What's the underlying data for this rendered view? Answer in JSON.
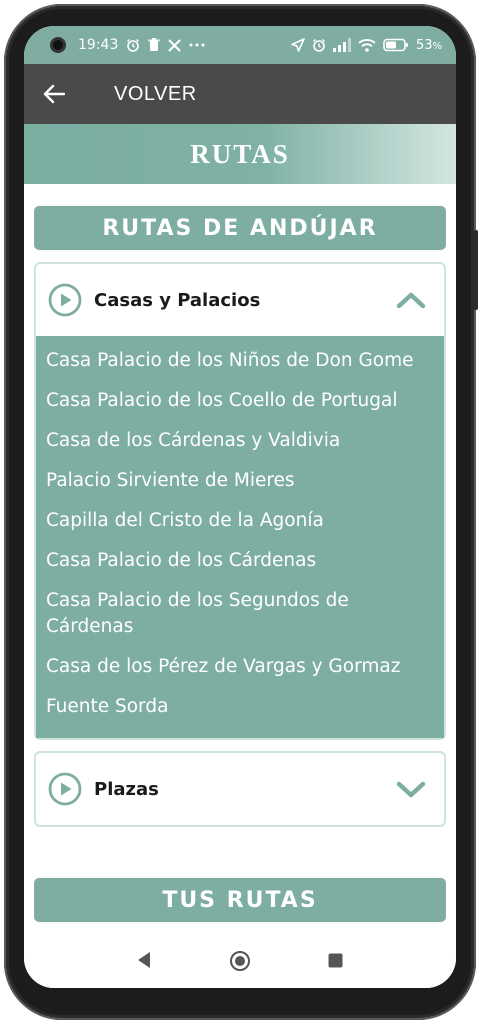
{
  "status_bar": {
    "time": "19:43",
    "battery_percent": "53",
    "icons_left": [
      "camera-dot",
      "alarm-icon",
      "trash-icon",
      "x-icon",
      "more-dots-icon"
    ],
    "icons_right": [
      "location-icon",
      "alarm-icon",
      "signal-icon",
      "wifi-icon",
      "battery-icon"
    ]
  },
  "app_bar": {
    "back_icon": "arrow-left-icon",
    "title": "VOLVER"
  },
  "banner": {
    "title": "RUTAS"
  },
  "sections": {
    "andujar_header": "RUTAS DE ANDÚJAR",
    "tus_rutas_header": "TUS RUTAS"
  },
  "accordions": [
    {
      "title": "Casas y Palacios",
      "expanded": true,
      "items": [
        "Casa Palacio de los Niños de Don Gome",
        "Casa Palacio de los Coello de Portugal",
        "Casa de los Cárdenas y Valdivia",
        "Palacio Sirviente de Mieres",
        "Capilla del Cristo de la Agonía",
        "Casa Palacio de los Cárdenas",
        "Casa Palacio de los Segundos de Cárdenas",
        "Casa de los Pérez de Vargas y Gormaz",
        "Fuente Sorda"
      ]
    },
    {
      "title": "Plazas",
      "expanded": false,
      "items": []
    }
  ],
  "colors": {
    "accent": "#7eaea2",
    "app_bar": "#4a4a4a",
    "status_bar": "#7fada1",
    "border": "#cfe3dd"
  },
  "nav_bar": {
    "back": "nav-back-icon",
    "home": "nav-home-icon",
    "recents": "nav-recents-icon"
  }
}
